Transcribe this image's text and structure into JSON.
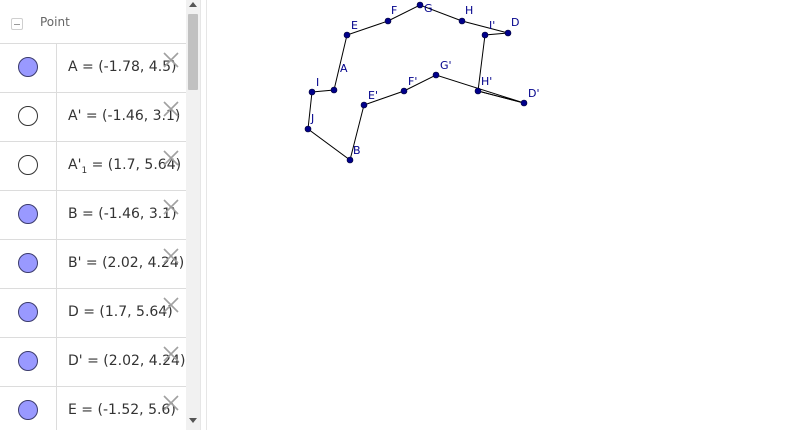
{
  "algebra": {
    "group_title": "Point",
    "rows": [
      {
        "marble": true,
        "pre": "A = (-1.78, 4.5)",
        "sub": "",
        "post": ""
      },
      {
        "marble": false,
        "pre": "A' = (-1.46, 3.1)",
        "sub": "",
        "post": ""
      },
      {
        "marble": false,
        "pre": "A'",
        "sub": "1",
        "post": " = (1.7, 5.64)"
      },
      {
        "marble": true,
        "pre": "B = (-1.46, 3.1)",
        "sub": "",
        "post": ""
      },
      {
        "marble": true,
        "pre": "B' = (2.02, 4.24)",
        "sub": "",
        "post": ""
      },
      {
        "marble": true,
        "pre": "D = (1.7, 5.64)",
        "sub": "",
        "post": ""
      },
      {
        "marble": true,
        "pre": "D' = (2.02, 4.24)",
        "sub": "",
        "post": ""
      },
      {
        "marble": true,
        "pre": "E = (-1.52, 5.6)",
        "sub": "",
        "post": ""
      }
    ]
  },
  "graphics": {
    "point_color": "#00008b",
    "line_color": "#000000",
    "labels": {
      "A": "A",
      "B": "B",
      "D": "D",
      "E": "E",
      "F": "F",
      "G": "G",
      "H": "H",
      "I": "I",
      "J": "J",
      "Ip": "I'",
      "Dp": "D'",
      "Ep": "E'",
      "Fp": "F'",
      "Gp": "G'",
      "Hp": "H'"
    }
  }
}
